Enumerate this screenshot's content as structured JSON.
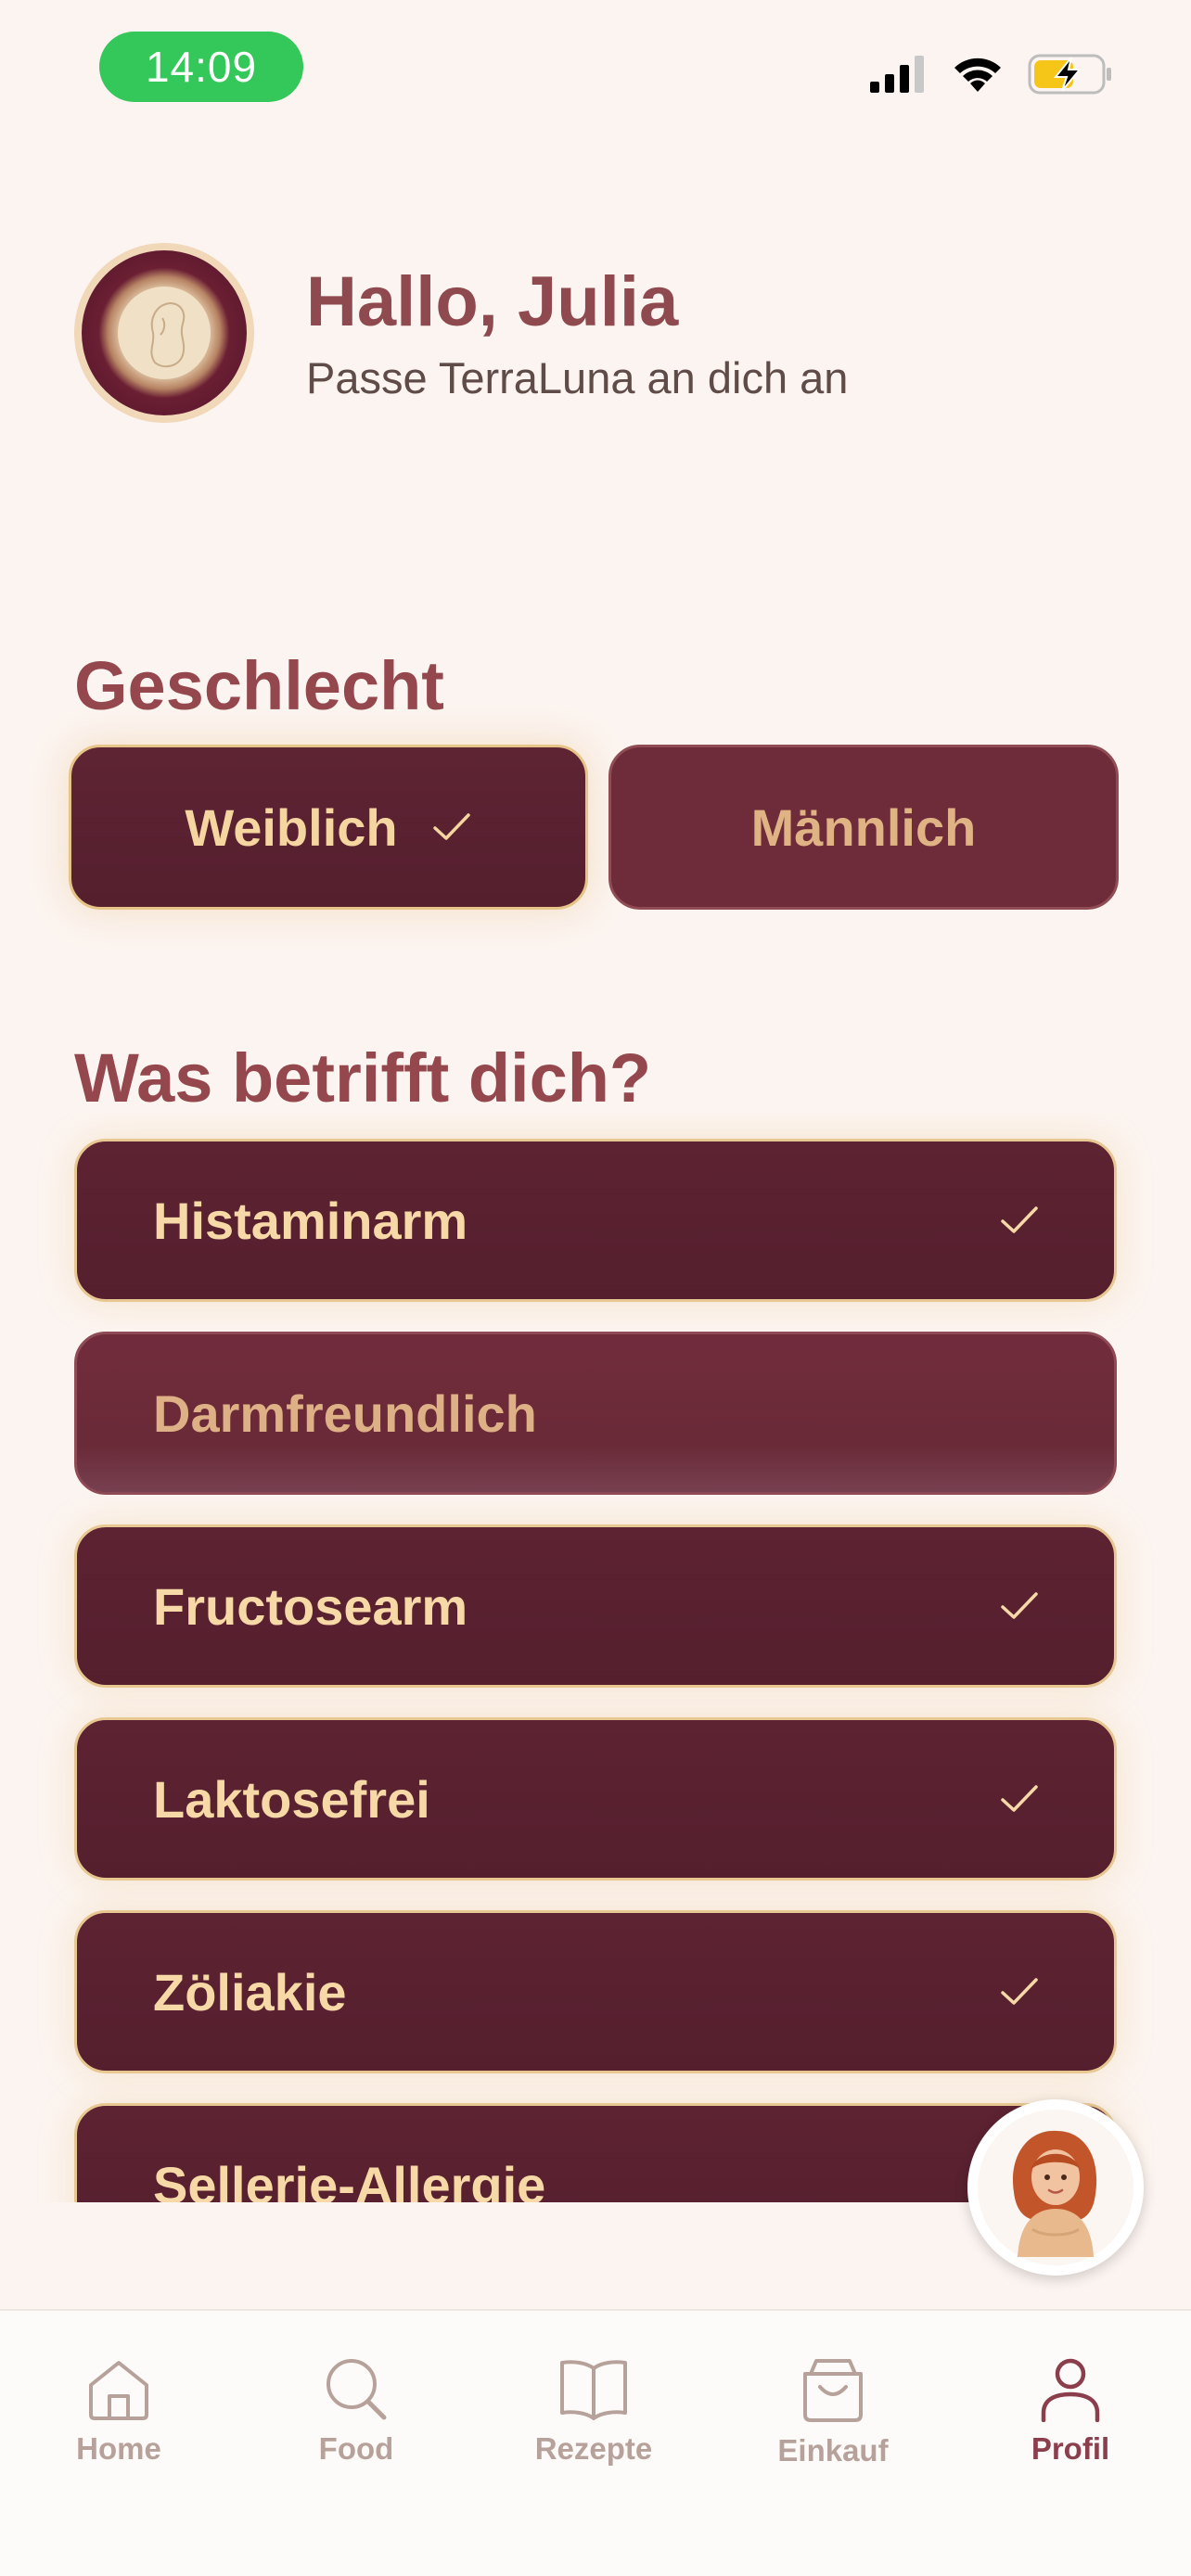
{
  "status_bar": {
    "time": "14:09"
  },
  "header": {
    "greeting": "Hallo, Julia",
    "subtitle": "Passe TerraLuna an dich an"
  },
  "gender": {
    "title": "Geschlecht",
    "options": [
      {
        "label": "Weiblich",
        "selected": true
      },
      {
        "label": "Männlich",
        "selected": false
      }
    ]
  },
  "concerns": {
    "title": "Was betrifft dich?",
    "options": [
      {
        "label": "Histaminarm",
        "selected": true
      },
      {
        "label": "Darmfreundlich",
        "selected": false
      },
      {
        "label": "Fructosearm",
        "selected": true
      },
      {
        "label": "Laktosefrei",
        "selected": true
      },
      {
        "label": "Zöliakie",
        "selected": true
      },
      {
        "label": "Sellerie-Allergie",
        "selected": true
      }
    ]
  },
  "tabbar": {
    "items": [
      {
        "label": "Home",
        "icon": "home-icon",
        "active": false
      },
      {
        "label": "Food",
        "icon": "search-icon",
        "active": false
      },
      {
        "label": "Rezepte",
        "icon": "book-icon",
        "active": false
      },
      {
        "label": "Einkauf",
        "icon": "shopping-bag-icon",
        "active": false
      },
      {
        "label": "Profil",
        "icon": "person-icon",
        "active": true
      }
    ]
  },
  "colors": {
    "background": "#fcf4f0",
    "accent": "#8b3f4c",
    "selected_fill": "#5a2131",
    "selected_text": "#f5d5a0"
  }
}
